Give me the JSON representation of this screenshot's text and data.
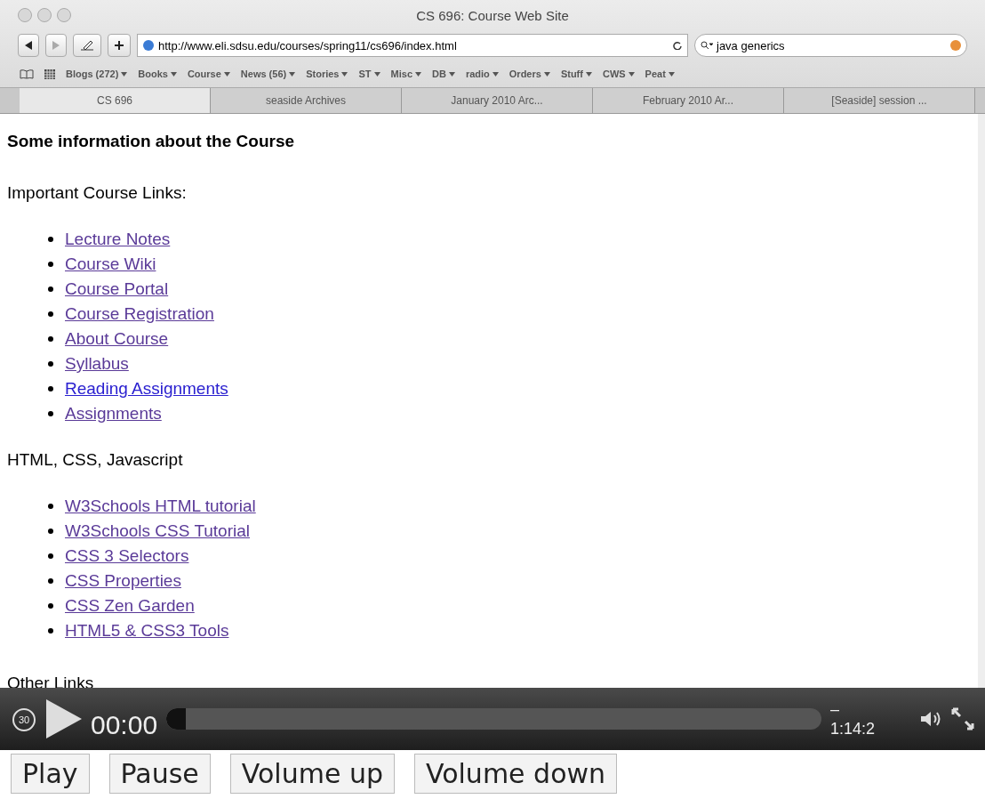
{
  "window": {
    "title": "CS 696: Course Web Site"
  },
  "toolbar": {
    "url": "http://www.eli.sdsu.edu/courses/spring11/cs696/index.html",
    "search": "java generics"
  },
  "bookmarks": [
    "Blogs (272)",
    "Books",
    "Course",
    "News (56)",
    "Stories",
    "ST",
    "Misc",
    "DB",
    "radio",
    "Orders",
    "Stuff",
    "CWS",
    "Peat"
  ],
  "tabs": [
    {
      "label": "CS 696",
      "selected": true
    },
    {
      "label": "seaside Archives",
      "selected": false
    },
    {
      "label": "January 2010 Arc...",
      "selected": false
    },
    {
      "label": "February 2010 Ar...",
      "selected": false
    },
    {
      "label": "[Seaside] session ...",
      "selected": false
    }
  ],
  "page": {
    "heading": "Some information about the Course",
    "sections": [
      {
        "title": "Important Course Links:",
        "links": [
          {
            "text": "Lecture Notes",
            "visited": true
          },
          {
            "text": "Course Wiki",
            "visited": true
          },
          {
            "text": "Course Portal",
            "visited": true
          },
          {
            "text": "Course Registration",
            "visited": true
          },
          {
            "text": "About Course",
            "visited": true
          },
          {
            "text": "Syllabus",
            "visited": true
          },
          {
            "text": "Reading Assignments",
            "visited": false
          },
          {
            "text": "Assignments",
            "visited": true
          }
        ]
      },
      {
        "title": "HTML, CSS, Javascript",
        "links": [
          {
            "text": "W3Schools HTML tutorial",
            "visited": true
          },
          {
            "text": "W3Schools CSS Tutorial",
            "visited": true
          },
          {
            "text": "CSS 3 Selectors",
            "visited": true
          },
          {
            "text": "CSS Properties",
            "visited": true
          },
          {
            "text": "CSS Zen Garden",
            "visited": true
          },
          {
            "text": "HTML5 & CSS3 Tools",
            "visited": true
          }
        ]
      },
      {
        "title": "Other Links"
      }
    ]
  },
  "player": {
    "skip_label": "30",
    "elapsed": "00:00",
    "remaining_sign": "–",
    "remaining": "1:14:2",
    "level": 0.03
  },
  "buttons": [
    "Play",
    "Pause",
    "Volume up",
    "Volume down"
  ]
}
